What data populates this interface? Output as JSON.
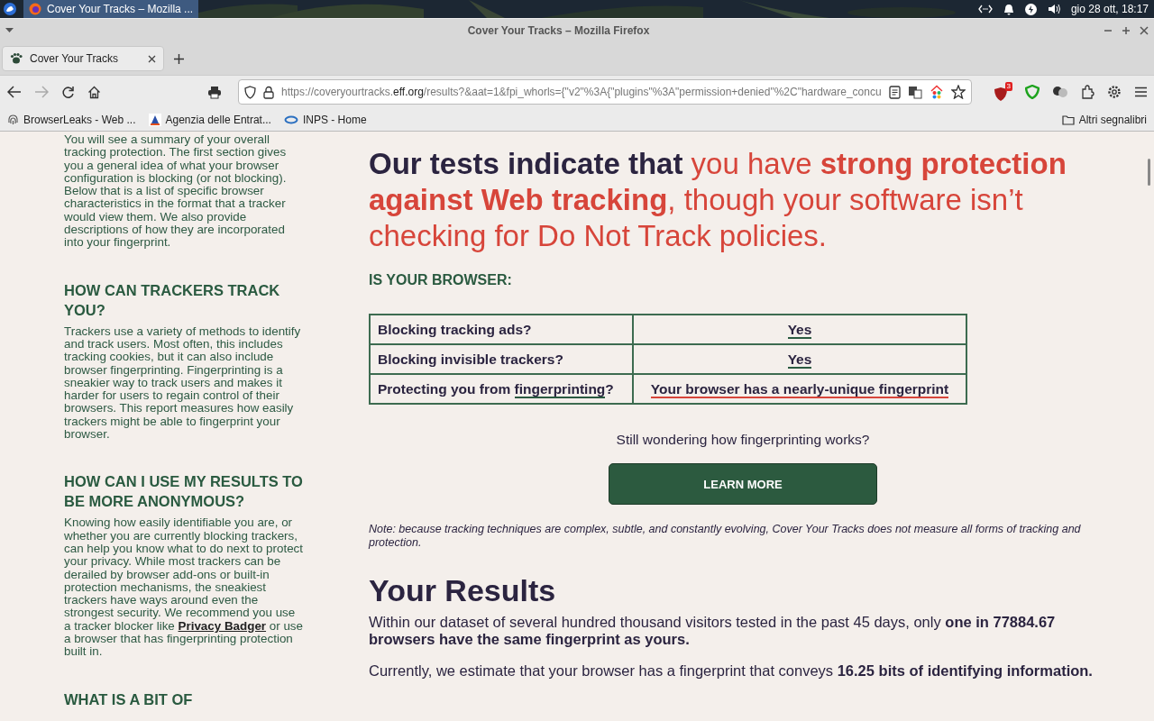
{
  "desktop_bar": {
    "taskbar_button": "Cover Your Tracks – Mozilla ...",
    "clock": "gio 28 ott, 18:17"
  },
  "window": {
    "title": "Cover Your Tracks – Mozilla Firefox"
  },
  "tabs": [
    {
      "label": "Cover Your Tracks",
      "selected": true
    }
  ],
  "toolbar": {
    "url_prefix": "https://coveryourtracks.",
    "url_domain": "eff.org",
    "url_rest": "/results?&aat=1&fpi_whorls={\"v2\"%3A{\"plugins\"%3A\"permission+denied\"%2C\"hardware_concu",
    "forward_disabled": true,
    "blocker_badge": "3"
  },
  "bookmarks": [
    {
      "label": "BrowserLeaks - Web ...",
      "kind": "fingerprint"
    },
    {
      "label": "Agenzia delle Entrat...",
      "kind": "agency"
    },
    {
      "label": "INPS - Home",
      "kind": "ring"
    }
  ],
  "other_bookmarks": "Altri segnalibri",
  "sidebar": [
    {
      "body": "You will see a summary of your overall tracking protection. The first section gives you a general idea of what your browser configuration is blocking (or not blocking). Below that is a list of specific browser characteristics in the format that a tracker would view them. We also provide descriptions of how they are incorporated into your fingerprint."
    },
    {
      "heading": "HOW CAN TRACKERS TRACK YOU?",
      "body": "Trackers use a variety of methods to identify and track users. Most often, this includes tracking cookies, but it can also include browser fingerprinting. Fingerprinting is a sneakier way to track users and makes it harder for users to regain control of their browsers. This report measures how easily trackers might be able to fingerprint your browser."
    },
    {
      "heading": "HOW CAN I USE MY RESULTS TO BE MORE ANONYMOUS?",
      "body": "Knowing how easily identifiable you are, or whether you are currently blocking trackers, can help you know what to do next to protect your privacy. While most trackers can be derailed by browser add-ons or built-in protection mechanisms, the sneakiest trackers have ways around even the strongest security. We recommend you use a tracker blocker like",
      "link": "Privacy Badger",
      "body_after": "or use a browser that has fingerprinting protection built in."
    },
    {
      "heading": "WHAT IS A BIT OF"
    }
  ],
  "headline": {
    "lead": "Our tests indicate that",
    "verdict": "you have **strong protection against Web tracking**, though your software isn’t checking for Do Not Track policies."
  },
  "browser_heading": "IS YOUR BROWSER:",
  "checks": [
    {
      "question": "Blocking tracking ads?",
      "answer": "Yes",
      "color": "#2a5a40"
    },
    {
      "question": "Blocking invisible trackers?",
      "answer": "Yes",
      "color": "#2a5a40"
    },
    {
      "question": "Protecting you from",
      "link": "fingerprinting",
      "suffix": "?",
      "answer": "Your browser has a nearly-unique fingerprint",
      "color": "#d7453a"
    }
  ],
  "prompt": "Still wondering how fingerprinting works?",
  "learn_button": "LEARN MORE",
  "note": "Note: because tracking techniques are complex, subtle, and constantly evolving, Cover Your Tracks does not measure all forms of tracking and protection.",
  "results_heading": "Your Results",
  "results": [
    "Within our dataset of several hundred thousand visitors tested in the past 45 days, only **one in 77884.67 browsers have the same fingerprint as yours.**",
    "Currently, we estimate that your browser has a fingerprint that conveys **16.25 bits of identifying information.**"
  ]
}
